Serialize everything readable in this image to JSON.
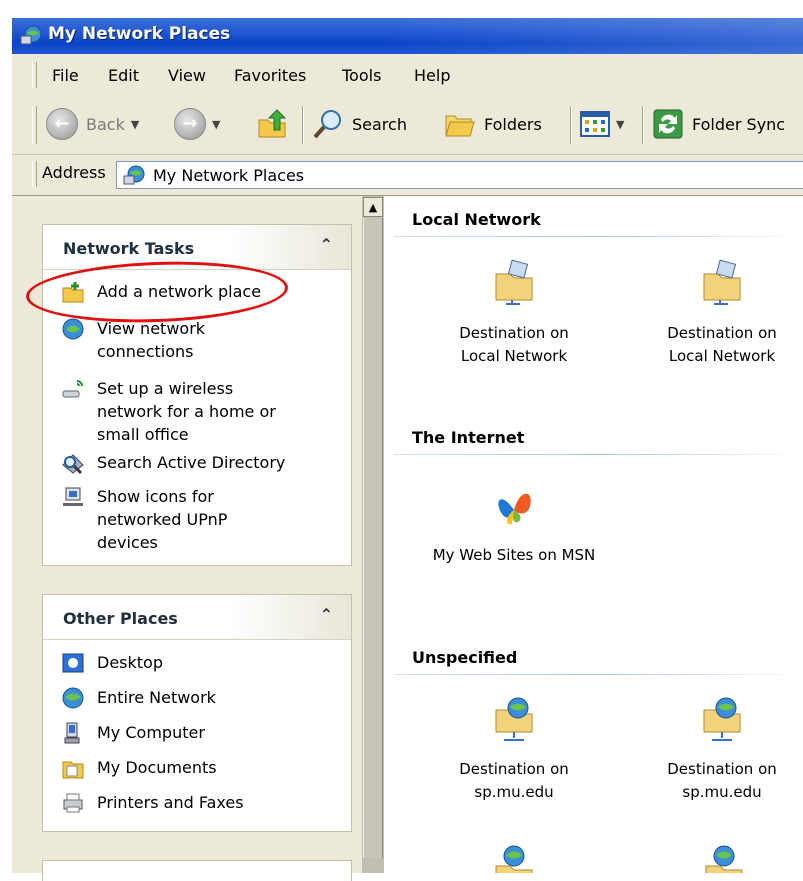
{
  "window": {
    "title": "My Network Places",
    "title_icon": "network-places-icon"
  },
  "menu": {
    "items": [
      "File",
      "Edit",
      "View",
      "Favorites",
      "Tools",
      "Help"
    ]
  },
  "toolbar": {
    "back_label": "Back",
    "search_label": "Search",
    "folders_label": "Folders",
    "folder_sync_label": "Folder Sync"
  },
  "address": {
    "label": "Address",
    "value": "My Network Places"
  },
  "network_tasks": {
    "title": "Network Tasks",
    "items": [
      {
        "label": "Add a network place",
        "icon": "add-network-place-icon"
      },
      {
        "label": "View network connections",
        "icon": "network-connections-icon"
      },
      {
        "label": "Set up a wireless network for a home or small office",
        "icon": "wireless-icon"
      },
      {
        "label": "Search Active Directory",
        "icon": "search-directory-icon"
      },
      {
        "label": "Show icons for networked UPnP devices",
        "icon": "upnp-icon"
      }
    ]
  },
  "other_places": {
    "title": "Other Places",
    "items": [
      {
        "label": "Desktop",
        "icon": "desktop-icon"
      },
      {
        "label": "Entire Network",
        "icon": "entire-network-icon"
      },
      {
        "label": "My Computer",
        "icon": "my-computer-icon"
      },
      {
        "label": "My Documents",
        "icon": "my-documents-icon"
      },
      {
        "label": "Printers and Faxes",
        "icon": "printers-icon"
      }
    ]
  },
  "groups": {
    "local": {
      "title": "Local Network",
      "items": [
        {
          "line1": "Destination on",
          "line2": "Local Network"
        },
        {
          "line1": "Destination on",
          "line2": "Local Network"
        }
      ]
    },
    "internet": {
      "title": "The Internet",
      "items": [
        {
          "line1": "My Web Sites on MSN"
        }
      ]
    },
    "unspecified": {
      "title": "Unspecified",
      "items": [
        {
          "line1": "Destination on",
          "line2": "sp.mu.edu"
        },
        {
          "line1": "Destination on",
          "line2": "sp.mu.edu"
        }
      ]
    }
  },
  "colors": {
    "highlight_ring": "#e01010",
    "titlebar": "#0a44c8",
    "chrome": "#ece9d8"
  }
}
